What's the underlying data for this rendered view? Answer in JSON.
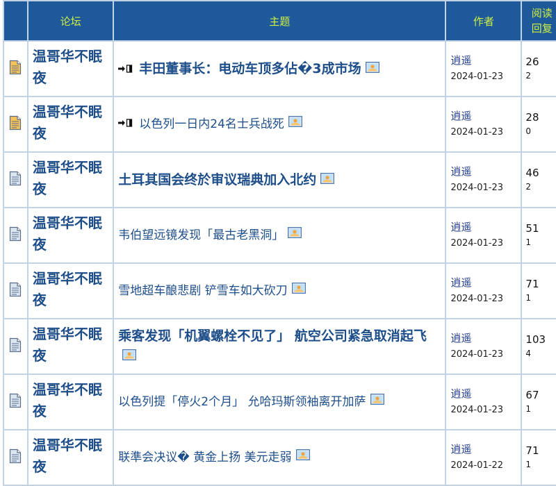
{
  "header": {
    "forum": "论坛",
    "topic": "主题",
    "author": "作者",
    "stats_top": "阅读",
    "stats_bottom": "回复"
  },
  "rows": [
    {
      "forum": "温哥华不眠夜",
      "title": "丰田董事长：电动车顶多佔�3成市场",
      "hot": true,
      "big": true,
      "author": "逍遥",
      "date": "2024-01-23",
      "views": "26",
      "replies": "2",
      "icon_color": "orange"
    },
    {
      "forum": "温哥华不眠夜",
      "title": "以色列一日内24名士兵战死",
      "hot": true,
      "big": false,
      "author": "逍遥",
      "date": "2024-01-23",
      "views": "28",
      "replies": "0",
      "icon_color": "orange"
    },
    {
      "forum": "温哥华不眠夜",
      "title": "土耳其国会终於审议瑞典加入北约",
      "hot": false,
      "big": true,
      "author": "逍遥",
      "date": "2024-01-23",
      "views": "46",
      "replies": "2",
      "icon_color": "blue"
    },
    {
      "forum": "温哥华不眠夜",
      "title": "韦伯望远镜发现「最古老黑洞」",
      "hot": false,
      "big": false,
      "author": "逍遥",
      "date": "2024-01-23",
      "views": "51",
      "replies": "1",
      "icon_color": "blue"
    },
    {
      "forum": "温哥华不眠夜",
      "title": "雪地超车酿悲剧 铲雪车如大砍刀",
      "hot": false,
      "big": false,
      "author": "逍遥",
      "date": "2024-01-23",
      "views": "71",
      "replies": "1",
      "icon_color": "blue"
    },
    {
      "forum": "温哥华不眠夜",
      "title": "乘客发现「机翼螺栓不见了」 航空公司紧急取消起飞",
      "hot": false,
      "big": true,
      "author": "逍遥",
      "date": "2024-01-23",
      "views": "103",
      "replies": "4",
      "icon_color": "blue"
    },
    {
      "forum": "温哥华不眠夜",
      "title": "以色列提「停火2个月」 允哈玛斯领袖离开加萨",
      "hot": false,
      "big": false,
      "author": "逍遥",
      "date": "2024-01-23",
      "views": "67",
      "replies": "1",
      "icon_color": "blue"
    },
    {
      "forum": "温哥华不眠夜",
      "title": "联準会决议� 黄金上扬 美元走弱",
      "hot": false,
      "big": false,
      "author": "逍遥",
      "date": "2024-01-22",
      "views": "71",
      "replies": "1",
      "icon_color": "blue"
    }
  ],
  "colors": {
    "header_bg": "#1e5a9a",
    "header_text": "#cfee44",
    "link": "#1d4e8a",
    "border": "#c3d3e6"
  }
}
